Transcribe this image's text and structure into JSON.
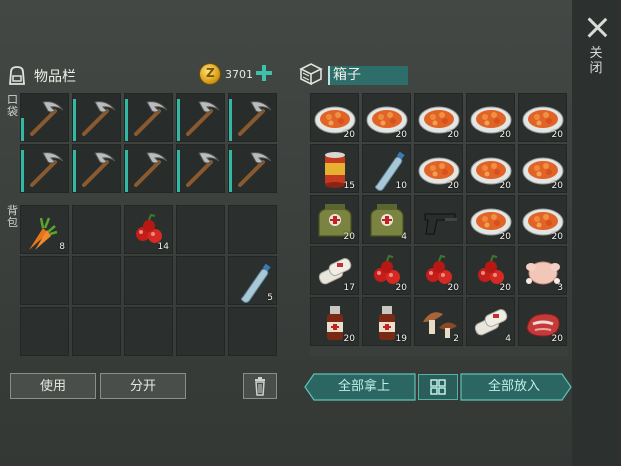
{
  "close": {
    "label": "关闭"
  },
  "inventory": {
    "title": "物品栏",
    "coins": "3701",
    "pocket_label": "口袋",
    "backpack_label": "背包",
    "pocket_slots": [
      {
        "item": "pickaxe-icon",
        "durability": 0.5
      },
      {
        "item": "pickaxe-icon",
        "durability": 0.9
      },
      {
        "item": "pickaxe-icon",
        "durability": 0.9
      },
      {
        "item": "pickaxe-icon",
        "durability": 0.9
      },
      {
        "item": "pickaxe-icon",
        "durability": 0.9
      },
      {
        "item": "pickaxe-icon",
        "durability": 0.9
      },
      {
        "item": "pickaxe-icon",
        "durability": 0.9
      },
      {
        "item": "pickaxe-icon",
        "durability": 0.9
      },
      {
        "item": "pickaxe-icon",
        "durability": 0.9
      },
      {
        "item": "pickaxe-icon",
        "durability": 0.9
      }
    ],
    "backpack_slots": [
      {
        "item": "carrot-icon",
        "qty": "8"
      },
      {
        "item": "",
        "qty": ""
      },
      {
        "item": "berries-icon",
        "qty": "14"
      },
      {
        "item": "",
        "qty": ""
      },
      {
        "item": "",
        "qty": ""
      },
      {
        "item": "",
        "qty": ""
      },
      {
        "item": "",
        "qty": ""
      },
      {
        "item": "",
        "qty": ""
      },
      {
        "item": "",
        "qty": ""
      },
      {
        "item": "water-bottle-icon",
        "qty": "5"
      },
      {
        "item": "",
        "qty": ""
      },
      {
        "item": "",
        "qty": ""
      },
      {
        "item": "",
        "qty": ""
      },
      {
        "item": "",
        "qty": ""
      },
      {
        "item": "",
        "qty": ""
      }
    ],
    "use_label": "使用",
    "split_label": "分开"
  },
  "box": {
    "title": "箱子",
    "slots": [
      {
        "item": "stew-plate-icon",
        "qty": "20"
      },
      {
        "item": "stew-plate-icon",
        "qty": "20"
      },
      {
        "item": "stew-plate-icon",
        "qty": "20"
      },
      {
        "item": "stew-plate-icon",
        "qty": "20"
      },
      {
        "item": "stew-plate-icon",
        "qty": "20"
      },
      {
        "item": "canned-food-icon",
        "qty": "15"
      },
      {
        "item": "water-bottle-icon",
        "qty": "10"
      },
      {
        "item": "stew-plate-icon",
        "qty": "20"
      },
      {
        "item": "stew-plate-icon",
        "qty": "20"
      },
      {
        "item": "stew-plate-icon",
        "qty": "20"
      },
      {
        "item": "medkit-bag-icon",
        "qty": "20"
      },
      {
        "item": "medkit-bag-icon",
        "qty": "4"
      },
      {
        "item": "pistol-icon",
        "qty": ""
      },
      {
        "item": "stew-plate-icon",
        "qty": "20"
      },
      {
        "item": "stew-plate-icon",
        "qty": "20"
      },
      {
        "item": "bandage-icon",
        "qty": "17"
      },
      {
        "item": "berries-icon",
        "qty": "20"
      },
      {
        "item": "berries-icon",
        "qty": "20"
      },
      {
        "item": "berries-icon",
        "qty": "20"
      },
      {
        "item": "raw-chicken-icon",
        "qty": "3"
      },
      {
        "item": "medicine-bottle-icon",
        "qty": "20"
      },
      {
        "item": "medicine-bottle-icon",
        "qty": "19"
      },
      {
        "item": "mushroom-icon",
        "qty": "2"
      },
      {
        "item": "bandage-icon",
        "qty": "4"
      },
      {
        "item": "raw-meat-icon",
        "qty": "20"
      }
    ],
    "take_all_label": "全部拿上",
    "put_all_label": "全部放入"
  }
}
